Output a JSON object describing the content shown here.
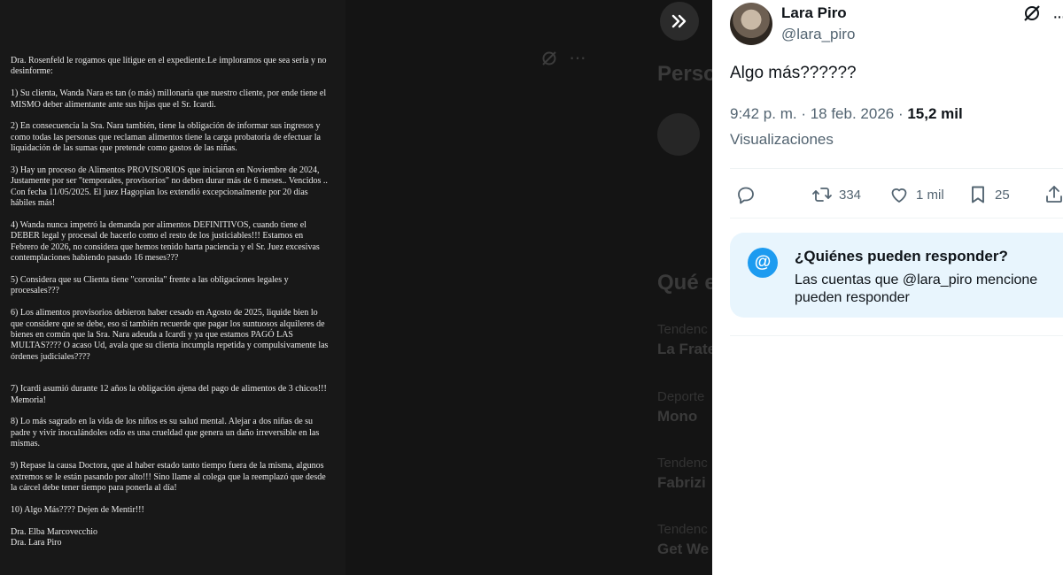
{
  "letter": {
    "paragraphs": [
      "Dra. Rosenfeld le rogamos que litigue en el expediente.Le imploramos que sea seria y no desinforme:",
      "1) Su clienta, Wanda Nara es tan (o más) millonaria que nuestro cliente, por ende tiene el MISMO deber alimentante ante sus hijas que el Sr. Icardi.",
      "2) En consecuencia la Sra. Nara también,  tiene la obligación de informar sus ingresos y como todas las personas que reclaman alimentos tiene la carga probatoria de efectuar la liquidación de las sumas que pretende como gastos de las niñas.",
      "3) Hay un proceso de Alimentos PROVISORIOS que iniciaron en Noviembre de 2024, Justamente por ser \"temporales, provisorios\" no deben durar más de 6 meses.. Vencidos .. Con fecha 11/05/2025. El juez Hagopian los extendió excepcionalmente por 20 días hábiles más!",
      "4) Wanda nunca impetró la demanda por alimentos DEFINITIVOS, cuando tiene el DEBER legal y procesal de hacerlo como el resto de los justiciables!!! Estamos en Febrero de 2026, no considera que hemos tenido harta paciencia y el Sr. Juez excesivas contemplaciones habiendo pasado 16 meses???",
      "5) Considera que su Clienta tiene \"coronita\" frente a las obligaciones legales y procesales???",
      "6) Los alimentos provisorios debieron haber cesado en Agosto de 2025, liquide bien lo que considere que se debe, eso sí también recuerde que pagar los suntuosos alquileres de bienes en común que la Sra. Nara adeuda a Icardi y ya que estamos PAGÓ LAS MULTAS???? O acaso Ud, avala que su clienta incumpla repetida y compulsivamente las órdenes judiciales????",
      "7) Icardi asumió durante 12 años la obligación ajena del pago de alimentos de 3 chicos!!! Memoria!",
      "8) Lo más sagrado en la vida de los niños es su salud mental. Alejar a dos niñas de su padre y vivir inoculándoles odio es una crueldad que genera un daño irreversible en las mismas.",
      "9) Repase la causa Doctora, que al haber estado tanto tiempo fuera de la misma, algunos extremos se le están pasando por alto!!! Sino llame al colega que la reemplazó que desde la cárcel debe tener tiempo para ponerla al día!",
      "10) Algo Más????  Dejen de Mentir!!!"
    ],
    "signature": "Dra. Elba Marcovecchio\nDra. Lara Piro"
  },
  "backdrop": {
    "heading_1": "Perso",
    "heading_2": "Qué e",
    "trends": [
      {
        "category": "Tendenc",
        "name": "La Frate"
      },
      {
        "category": "Deporte",
        "name": "Mono"
      },
      {
        "category": "Tendenc",
        "name": "Fabrizi"
      },
      {
        "category": "Tendenc",
        "name": "Get We"
      }
    ]
  },
  "tweet": {
    "author_name": "Lara Piro",
    "author_handle": "@lara_piro",
    "text": "Algo más??????",
    "time": "9:42 p. m. · 18 feb. 2026 · ",
    "views_count": "15,2 mil",
    "views_label": "Visualizaciones",
    "actions": {
      "retweets": "334",
      "likes": "1 mil",
      "bookmarks": "25"
    },
    "reply_settings": {
      "title": "¿Quiénes pueden responder?",
      "description": "Las cuentas que @lara_piro mencione pueden responder"
    }
  },
  "icons": {
    "expand": "double-chevron-right-icon",
    "grok": "grok-icon",
    "more": "more-icon",
    "reply": "reply-icon",
    "retweet": "retweet-icon",
    "like": "heart-icon",
    "bookmark": "bookmark-icon",
    "share": "share-icon",
    "mention": "at-icon"
  },
  "colors": {
    "accent": "#1d9bf0",
    "secondary_text": "#536471",
    "reply_box_bg": "#e8f5fd"
  }
}
